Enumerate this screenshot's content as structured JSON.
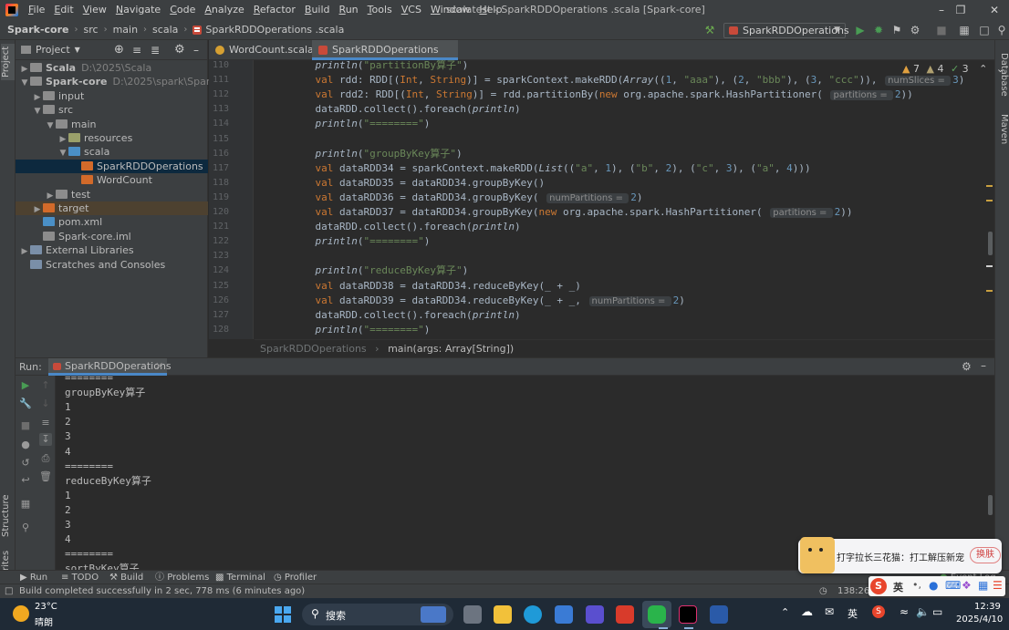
{
  "colors": {
    "accent": "#4a88c7",
    "keyword": "#cc7832",
    "string": "#6a8759",
    "number": "#6897bb",
    "italic_fn": "#a9b7c6",
    "run_green": "#499c54"
  },
  "window": {
    "menu": [
      "File",
      "Edit",
      "View",
      "Navigate",
      "Code",
      "Analyze",
      "Refactor",
      "Build",
      "Run",
      "Tools",
      "VCS",
      "Window",
      "Help"
    ],
    "title": "scalatest - SparkRDDOperations .scala [Spark-core]"
  },
  "nav": {
    "crumbs": [
      "Spark-core",
      "src",
      "main",
      "scala",
      "SparkRDDOperations .scala"
    ],
    "run_config": "SparkRDDOperations"
  },
  "project": {
    "header": "Project",
    "tree": [
      {
        "label": "Scala",
        "path": "D:\\2025\\Scala",
        "indent": 0,
        "arrow": "▶",
        "icon": "f-folder",
        "bold": true
      },
      {
        "label": "Spark-core",
        "path": "D:\\2025\\spark\\Spark-core",
        "indent": 0,
        "arrow": "▼",
        "icon": "f-folder",
        "bold": true
      },
      {
        "label": "input",
        "path": "",
        "indent": 1,
        "arrow": "▶",
        "icon": "f-folder"
      },
      {
        "label": "src",
        "path": "",
        "indent": 1,
        "arrow": "▼",
        "icon": "f-folder"
      },
      {
        "label": "main",
        "path": "",
        "indent": 2,
        "arrow": "▼",
        "icon": "f-folder"
      },
      {
        "label": "resources",
        "path": "",
        "indent": 3,
        "arrow": "▶",
        "icon": "f-res"
      },
      {
        "label": "scala",
        "path": "",
        "indent": 3,
        "arrow": "▼",
        "icon": "f-src"
      },
      {
        "label": "SparkRDDOperations",
        "path": "",
        "indent": 4,
        "arrow": "",
        "icon": "f-orange",
        "selected": true
      },
      {
        "label": "WordCount",
        "path": "",
        "indent": 4,
        "arrow": "",
        "icon": "f-orange"
      },
      {
        "label": "test",
        "path": "",
        "indent": 2,
        "arrow": "▶",
        "icon": "f-folder"
      },
      {
        "label": "target",
        "path": "",
        "indent": 1,
        "arrow": "▶",
        "icon": "f-orange",
        "highlight": true
      },
      {
        "label": "pom.xml",
        "path": "",
        "indent": 1,
        "arrow": "",
        "icon": "f-src"
      },
      {
        "label": "Spark-core.iml",
        "path": "",
        "indent": 1,
        "arrow": "",
        "icon": "f-folder"
      },
      {
        "label": "External Libraries",
        "path": "",
        "indent": 0,
        "arrow": "▶",
        "icon": "f-lib"
      },
      {
        "label": "Scratches and Consoles",
        "path": "",
        "indent": 0,
        "arrow": "",
        "icon": "f-lib"
      }
    ]
  },
  "editor": {
    "tabs": [
      {
        "label": "WordCount.scala",
        "active": false
      },
      {
        "label": "SparkRDDOperations .scala",
        "active": true
      }
    ],
    "inspections": {
      "warnings": "7",
      "weak": "4",
      "ok": "3"
    },
    "lines": [
      {
        "n": "110",
        "html": "    <i>println</i>(<span class='s'>\"partitionBy算子\"</span>)"
      },
      {
        "n": "111",
        "html": "    <span class='k'>val</span> rdd: RDD[(<span class='k'>Int</span>, <span class='k'>String</span>)] = sparkContext.makeRDD(<i>Array</i>((<span class='n'>1</span>, <span class='s'>\"aaa\"</span>), (<span class='n'>2</span>, <span class='s'>\"bbb\"</span>), (<span class='n'>3</span>, <span class='s'>\"ccc\"</span>)), <span class='hint'>numSlices = </span><span class='n'>3</span>)"
      },
      {
        "n": "112",
        "html": "    <span class='k'>val</span> rdd2: RDD[(<span class='k'>Int</span>, <span class='k'>String</span>)] = rdd.partitionBy(<span class='k'>new</span> org.apache.spark.HashPartitioner( <span class='hint'>partitions = </span><span class='n'>2</span>))"
      },
      {
        "n": "113",
        "html": "    dataRDD.collect().foreach(<i>println</i>)"
      },
      {
        "n": "114",
        "html": "    <i>println</i>(<span class='s'>\"========\"</span>)"
      },
      {
        "n": "115",
        "html": ""
      },
      {
        "n": "116",
        "html": "    <i>println</i>(<span class='s'>\"groupByKey算子\"</span>)"
      },
      {
        "n": "117",
        "html": "    <span class='k'>val</span> dataRDD34 = sparkContext.makeRDD(<i>List</i>((<span class='s'>\"a\"</span>, <span class='n'>1</span>), (<span class='s'>\"b\"</span>, <span class='n'>2</span>), (<span class='s'>\"c\"</span>, <span class='n'>3</span>), (<span class='s'>\"a\"</span>, <span class='n'>4</span>)))"
      },
      {
        "n": "118",
        "html": "    <span class='k'>val</span> dataRDD35 = dataRDD34.groupByKey()"
      },
      {
        "n": "119",
        "html": "    <span class='k'>val</span> dataRDD36 = dataRDD34.groupByKey( <span class='hint'>numPartitions = </span><span class='n'>2</span>)"
      },
      {
        "n": "120",
        "html": "    <span class='k'>val</span> dataRDD37 = dataRDD34.groupByKey(<span class='k'>new</span> org.apache.spark.HashPartitioner( <span class='hint'>partitions = </span><span class='n'>2</span>))"
      },
      {
        "n": "121",
        "html": "    dataRDD.collect().foreach(<i>println</i>)"
      },
      {
        "n": "122",
        "html": "    <i>println</i>(<span class='s'>\"========\"</span>)"
      },
      {
        "n": "123",
        "html": ""
      },
      {
        "n": "124",
        "html": "    <i>println</i>(<span class='s'>\"reduceByKey算子\"</span>)"
      },
      {
        "n": "125",
        "html": "    <span class='k'>val</span> dataRDD38 = dataRDD34.reduceByKey(_ + _)"
      },
      {
        "n": "126",
        "html": "    <span class='k'>val</span> dataRDD39 = dataRDD34.reduceByKey(_ + _, <span class='hint'>numPartitions = </span><span class='n'>2</span>)"
      },
      {
        "n": "127",
        "html": "    dataRDD.collect().foreach(<i>println</i>)"
      },
      {
        "n": "128",
        "html": "    <i>println</i>(<span class='s'>\"========\"</span>)"
      }
    ],
    "breadcrumb": [
      "SparkRDDOperations",
      "main(args: Array[String])"
    ]
  },
  "run": {
    "label": "Run:",
    "tab": "SparkRDDOperations",
    "output": [
      "========",
      "groupByKey算子",
      "1",
      "2",
      "3",
      "4",
      "========",
      "reduceByKey算子",
      "1",
      "2",
      "3",
      "4",
      "========",
      "sortByKey算子"
    ]
  },
  "bottom_tools": [
    "Run",
    "TODO",
    "Build",
    "Problems",
    "Terminal",
    "Profiler"
  ],
  "side_tabs": {
    "left": [
      "Project",
      "Structure",
      "Favorites"
    ],
    "right": [
      "Database",
      "Maven"
    ]
  },
  "status": {
    "message": "Build completed successfully in 2 sec, 778 ms (6 minutes ago)",
    "position": "138:26",
    "event_log": "Event Log"
  },
  "popup": {
    "text": "打字拉长三花猫：打工解压新宠",
    "button": "换肤"
  },
  "ime": {
    "lang": "英"
  },
  "taskbar": {
    "weather_temp": "23°C",
    "weather_desc": "晴朗",
    "search": "搜索",
    "lang": "英",
    "time": "12:39",
    "date": "2025/4/10"
  }
}
